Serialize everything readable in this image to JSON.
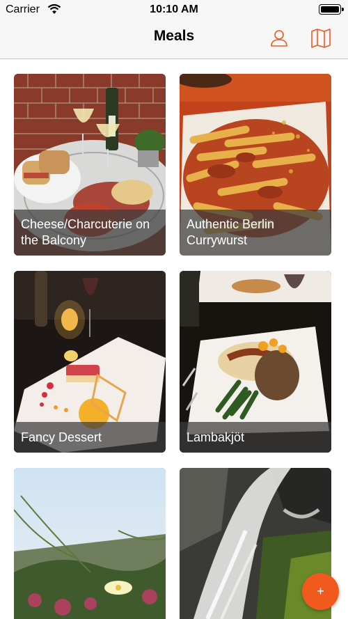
{
  "status_bar": {
    "carrier": "Carrier",
    "time": "10:10 AM"
  },
  "nav": {
    "title": "Meals",
    "profile_icon": "person-icon",
    "map_icon": "map-icon"
  },
  "colors": {
    "accent": "#f15a1f",
    "nav_bg": "#f7f7f7"
  },
  "meals": [
    {
      "title": "Cheese/Charcuterie on the Balcony"
    },
    {
      "title": "Authentic Berlin Currywurst"
    },
    {
      "title": "Fancy Dessert"
    },
    {
      "title": "Lambakjöt"
    },
    {
      "title": ""
    },
    {
      "title": ""
    }
  ],
  "fab": {
    "label": "+"
  }
}
